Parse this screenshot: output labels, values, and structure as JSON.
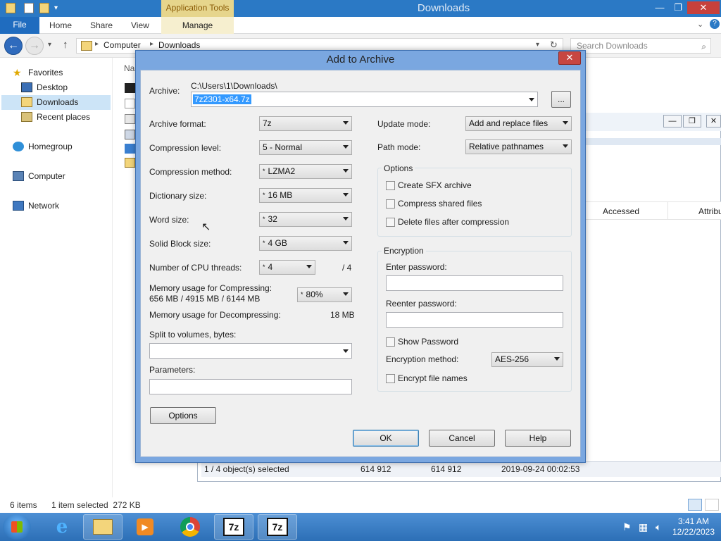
{
  "explorer": {
    "title": "Downloads",
    "context_tab": "Application Tools",
    "tabs": {
      "file": "File",
      "home": "Home",
      "share": "Share",
      "view": "View",
      "manage": "Manage"
    },
    "breadcrumb": {
      "root": "Computer",
      "current": "Downloads"
    },
    "search_placeholder": "Search Downloads",
    "nav": {
      "favorites": "Favorites",
      "desktop": "Desktop",
      "downloads": "Downloads",
      "recent": "Recent places",
      "homegroup": "Homegroup",
      "computer": "Computer",
      "network": "Network"
    },
    "column_stub": "Na",
    "status": {
      "items": "6 items",
      "selected": "1 item selected  272 KB"
    }
  },
  "bg_window": {
    "columns": {
      "accessed": "Accessed",
      "attributes": "Attribu"
    },
    "status": {
      "selected": "1 / 4 object(s) selected",
      "size1": "614 912",
      "size2": "614 912",
      "date": "2019-09-24 00:02:53"
    }
  },
  "dialog": {
    "title": "Add to Archive",
    "archive_label": "Archive:",
    "archive_path": "C:\\Users\\1\\Downloads\\",
    "archive_name": "7z2301-x64.7z",
    "browse_label": "...",
    "left": {
      "archive_format": {
        "label": "Archive format:",
        "value": "7z"
      },
      "compression_level": {
        "label": "Compression level:",
        "value": "5 - Normal"
      },
      "compression_method": {
        "label": "Compression method:",
        "value": "LZMA2"
      },
      "dictionary_size": {
        "label": "Dictionary size:",
        "value": "16 MB"
      },
      "word_size": {
        "label": "Word size:",
        "value": "32"
      },
      "solid_block": {
        "label": "Solid Block size:",
        "value": "4 GB"
      },
      "cpu_threads": {
        "label": "Number of CPU threads:",
        "value": "4",
        "max": "/ 4"
      },
      "mem_compress": {
        "label": "Memory usage for Compressing:",
        "detail": "656 MB / 4915 MB / 6144 MB",
        "value": "80%"
      },
      "mem_decompress": {
        "label": "Memory usage for Decompressing:",
        "value": "18 MB"
      },
      "split_label": "Split to volumes, bytes:",
      "split_value": "",
      "params_label": "Parameters:",
      "params_value": "",
      "options_button": "Options"
    },
    "right": {
      "update_mode": {
        "label": "Update mode:",
        "value": "Add and replace files"
      },
      "path_mode": {
        "label": "Path mode:",
        "value": "Relative pathnames"
      },
      "options_group": "Options",
      "sfx": "Create SFX archive",
      "shared": "Compress shared files",
      "delete_after": "Delete files after compression",
      "encryption_group": "Encryption",
      "enter_pw": "Enter password:",
      "reenter_pw": "Reenter password:",
      "show_pw": "Show Password",
      "enc_method": {
        "label": "Encryption method:",
        "value": "AES-256"
      },
      "encrypt_names": "Encrypt file names"
    },
    "buttons": {
      "ok": "OK",
      "cancel": "Cancel",
      "help": "Help"
    }
  },
  "taskbar": {
    "sevenzip_label": "7z",
    "time": "3:41 AM",
    "date": "12/22/2023"
  },
  "colors": {
    "title_blue": "#2b79c5",
    "context_gold": "#e6d58c",
    "selection": "#cce4f7"
  }
}
